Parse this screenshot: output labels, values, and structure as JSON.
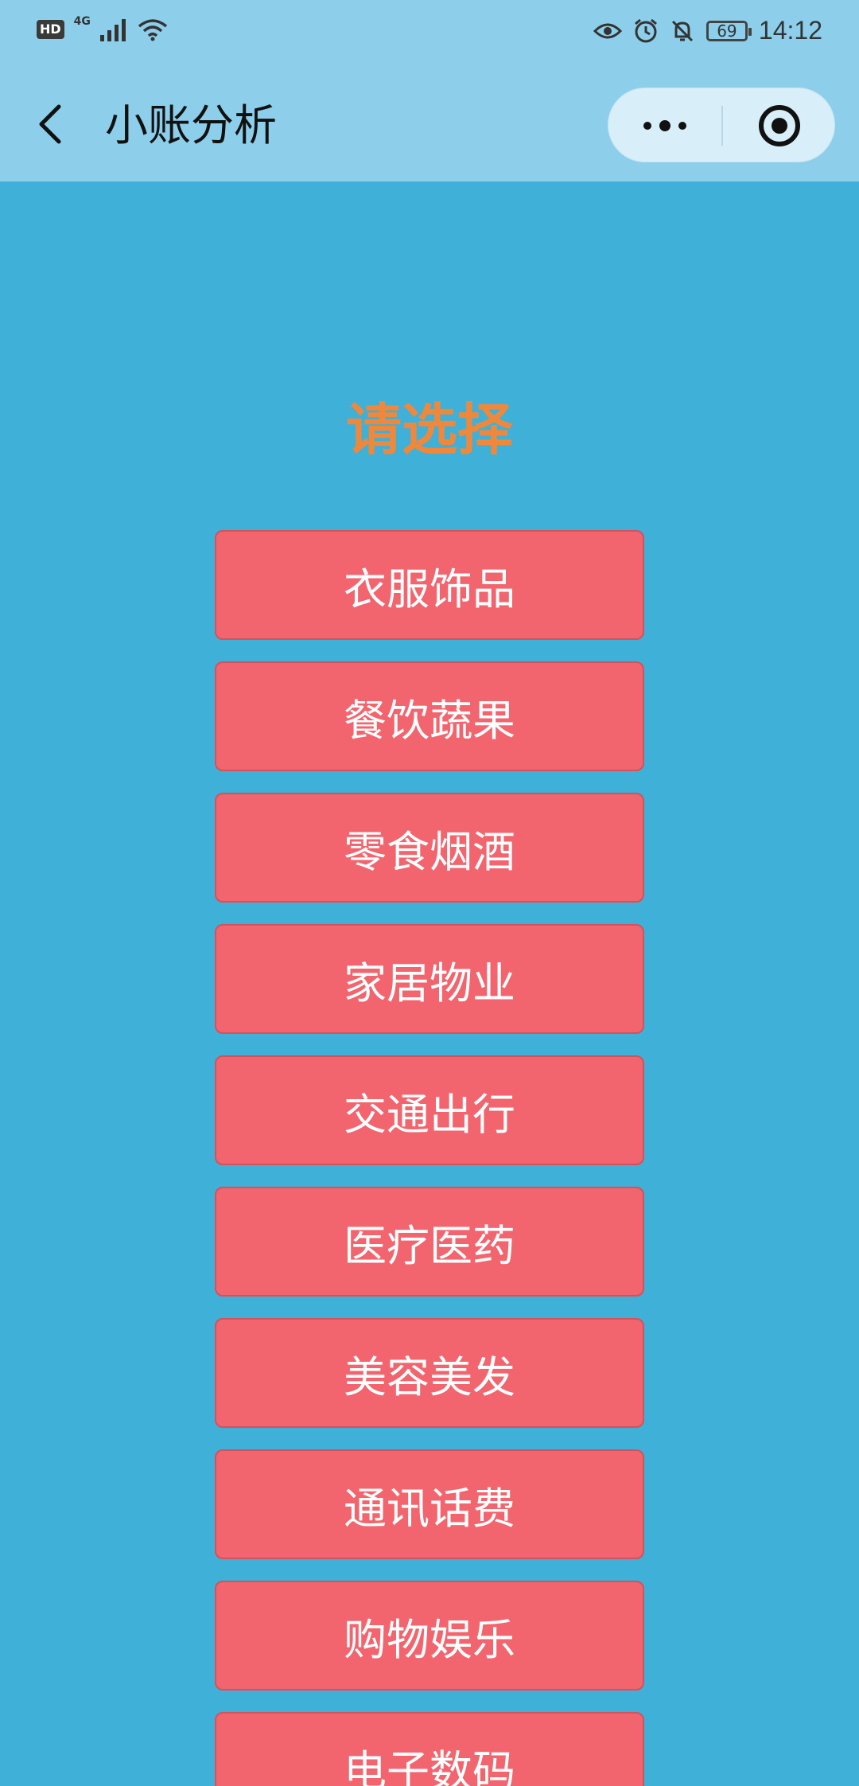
{
  "status_bar": {
    "hd_label": "HD",
    "network_type": "4G",
    "battery_level": "69",
    "time": "14:12"
  },
  "nav": {
    "title": "小账分析"
  },
  "main": {
    "prompt": "请选择",
    "categories": [
      {
        "label": "衣服饰品"
      },
      {
        "label": "餐饮蔬果"
      },
      {
        "label": "零食烟酒"
      },
      {
        "label": "家居物业"
      },
      {
        "label": "交通出行"
      },
      {
        "label": "医疗医药"
      },
      {
        "label": "美容美发"
      },
      {
        "label": "通讯话费"
      },
      {
        "label": "购物娱乐"
      },
      {
        "label": "电子数码"
      }
    ]
  },
  "colors": {
    "background": "#3fb0d8",
    "header": "#8dcfeb",
    "prompt": "#f0883c",
    "button": "#f2656e",
    "button_text": "#ffffff"
  },
  "icons": {
    "back": "chevron-left-icon",
    "more": "more-dots-icon",
    "close": "target-circle-icon"
  }
}
